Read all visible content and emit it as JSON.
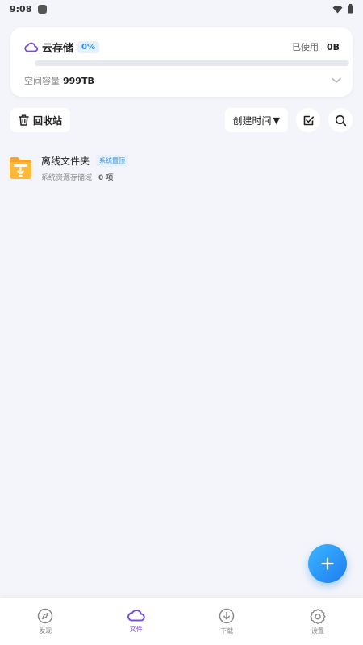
{
  "status": {
    "time": "9:08"
  },
  "storage": {
    "title": "云存储",
    "percent": "0%",
    "used_label": "已使用",
    "used_value": "0B",
    "progress": 0,
    "capacity_label": "空间容量",
    "capacity_value": "999TB"
  },
  "toolbar": {
    "recycle_label": "回收站",
    "sort_label": "创建时间",
    "sort_arrow": "▼"
  },
  "files": [
    {
      "name": "离线文件夹",
      "badge": "系统置顶",
      "desc": "系统资源存储域",
      "count": "0 项"
    }
  ],
  "nav": [
    {
      "label": "发现",
      "icon": "compass-icon",
      "active": false
    },
    {
      "label": "文件",
      "icon": "cloud-icon",
      "active": true
    },
    {
      "label": "下载",
      "icon": "download-icon",
      "active": false
    },
    {
      "label": "设置",
      "icon": "settings-icon",
      "active": false
    }
  ],
  "colors": {
    "accent": "#7b4de0",
    "badge_text": "#2f8de4",
    "badge_bg": "#e6f1fd",
    "folder": "#fdb83a",
    "fab": "#1e7df0",
    "background": "#f3f5fa"
  }
}
